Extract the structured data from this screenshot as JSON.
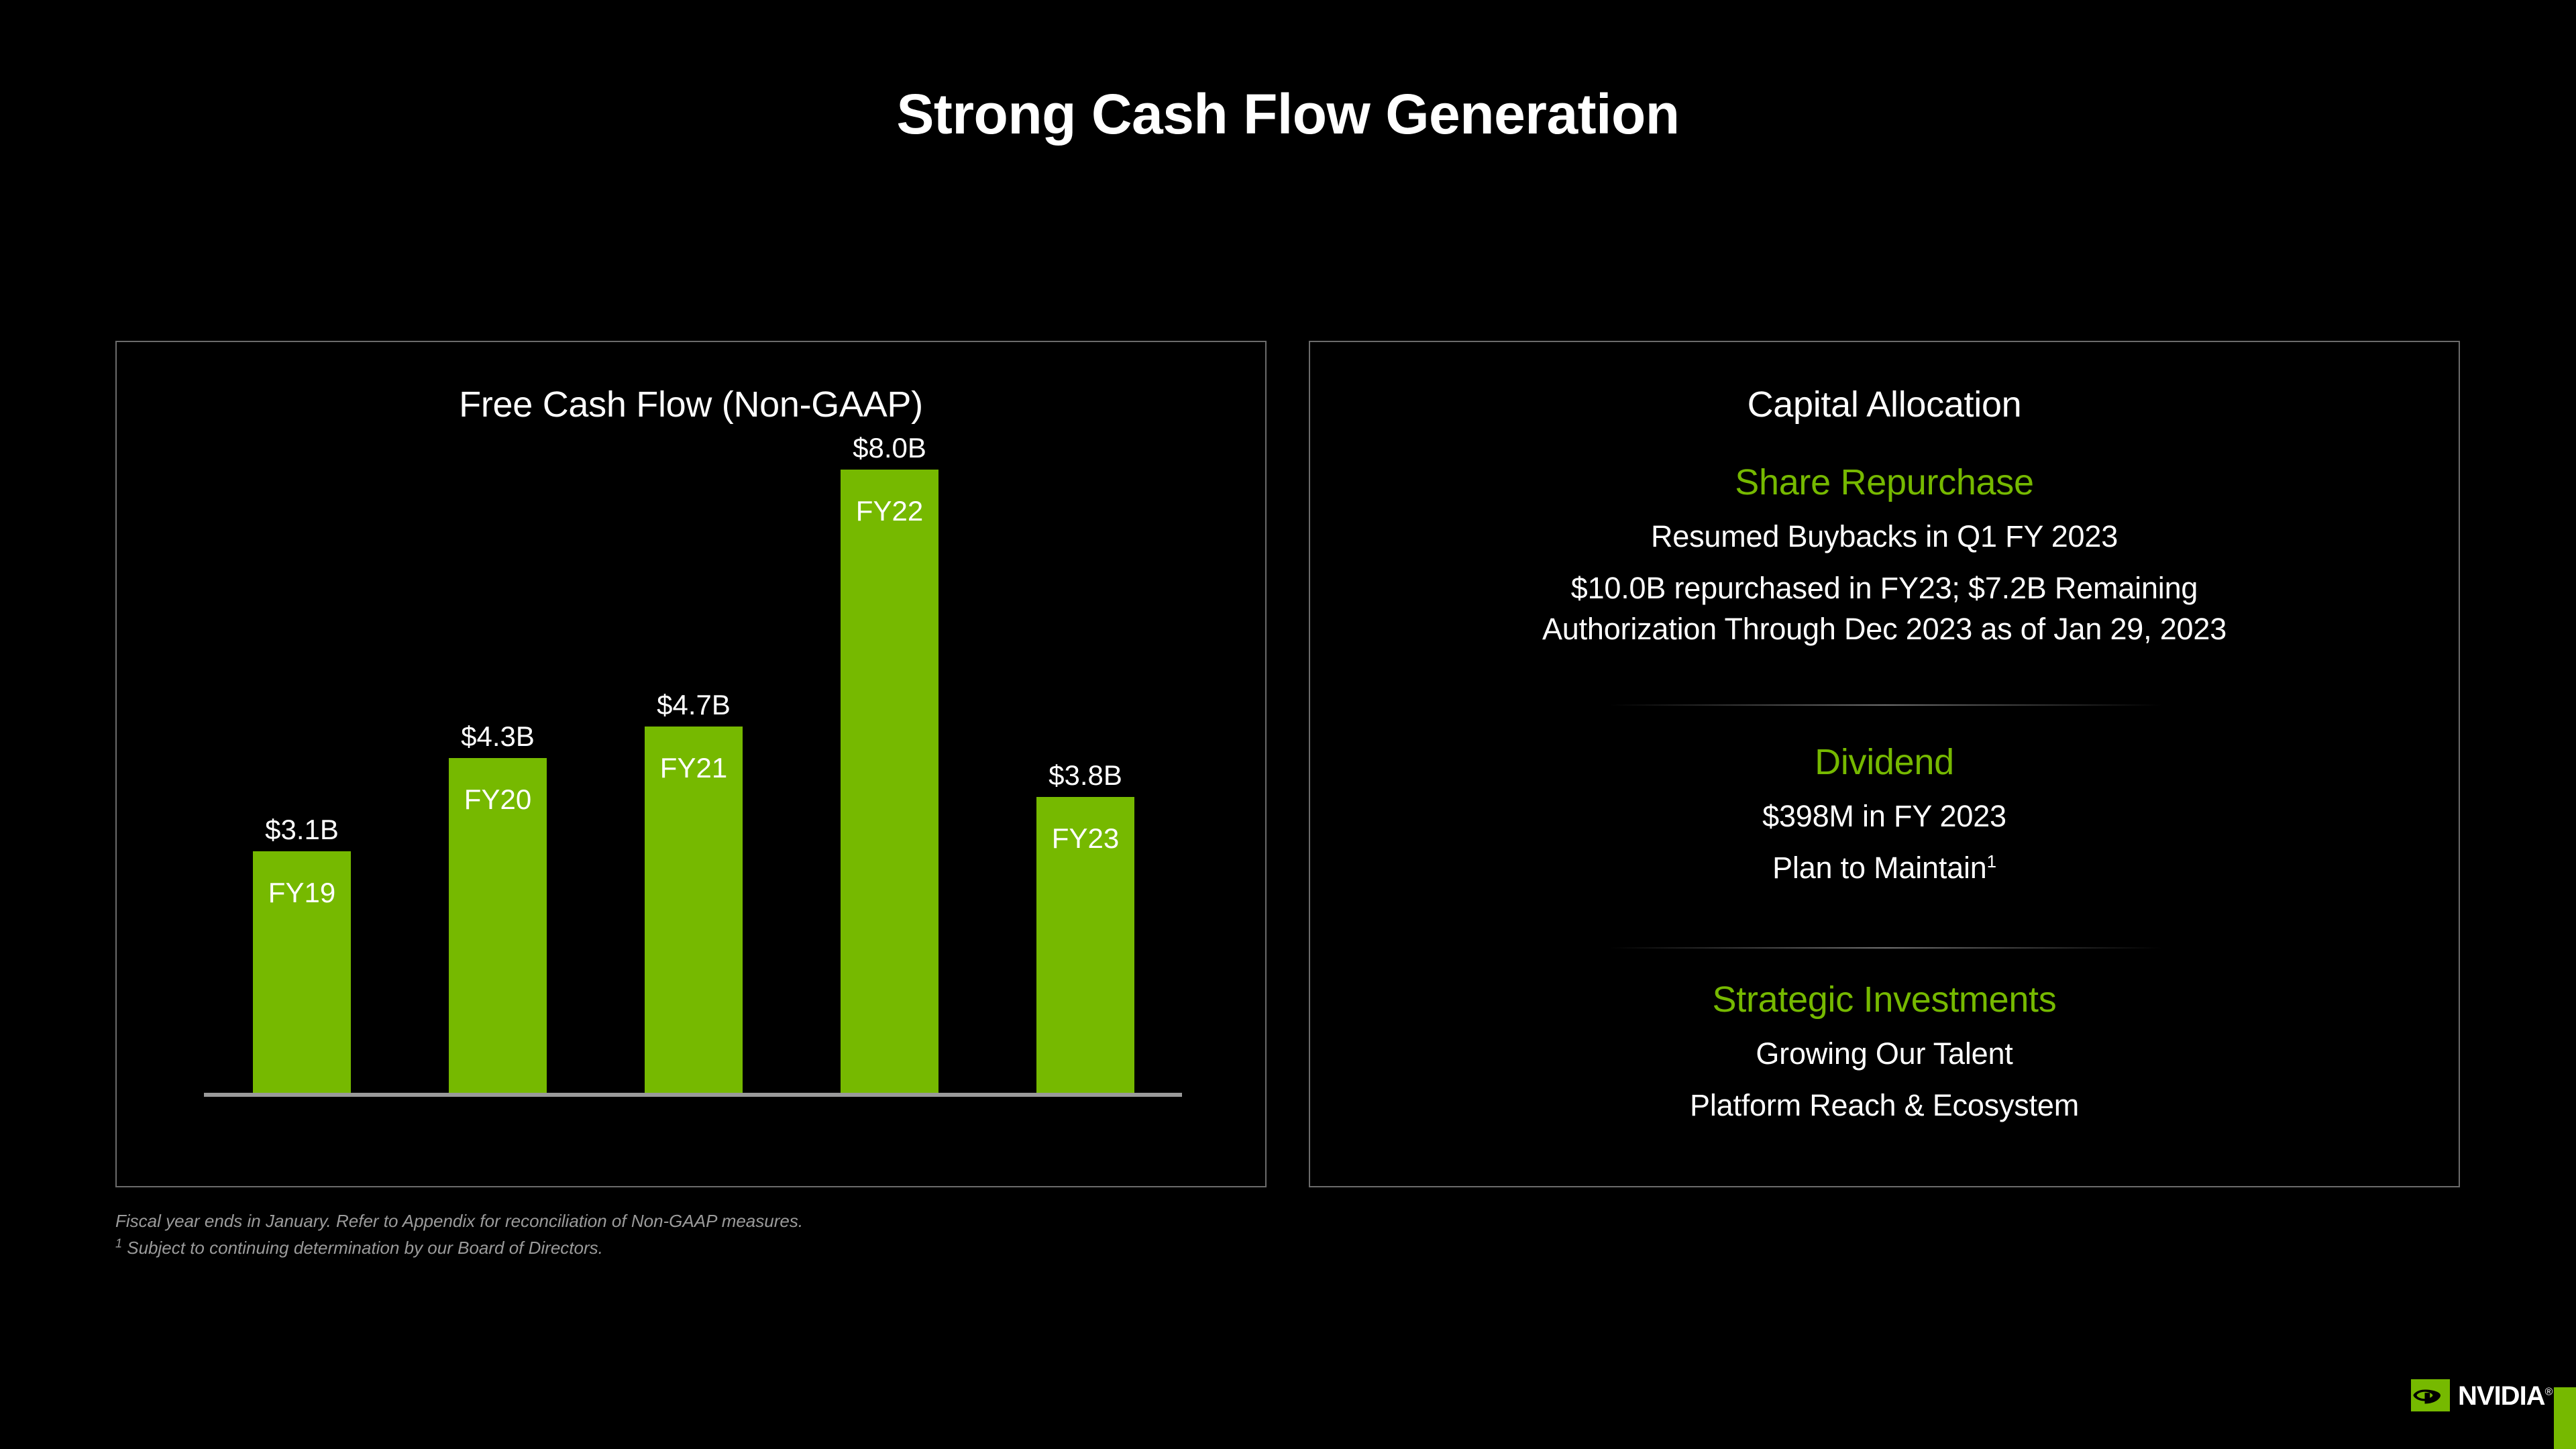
{
  "slide": {
    "title": "Strong Cash Flow Generation",
    "background_color": "#000000",
    "accent_color": "#76b900",
    "panel_border_color": "#6b6b6b"
  },
  "chart_panel": {
    "title": "Free Cash Flow (Non-GAAP)"
  },
  "chart_data": {
    "type": "bar",
    "title": "Free Cash Flow (Non-GAAP)",
    "xlabel": "",
    "ylabel": "",
    "categories": [
      "FY19",
      "FY20",
      "FY21",
      "FY22",
      "FY23"
    ],
    "values": [
      3.1,
      4.3,
      4.7,
      8.0,
      3.8
    ],
    "value_labels": [
      "$3.1B",
      "$4.3B",
      "$4.7B",
      "$8.0B",
      "$3.8B"
    ],
    "unit": "USD billions",
    "ylim": [
      0,
      8.0
    ],
    "grid": false,
    "legend": false,
    "bar_color": "#76b900",
    "axis_color": "#9a9a9a"
  },
  "capital_panel": {
    "title": "Capital Allocation",
    "sections": [
      {
        "heading": "Share Repurchase",
        "lines": [
          "Resumed Buybacks in Q1 FY 2023",
          "$10.0B repurchased in FY23; $7.2B Remaining",
          "Authorization Through Dec 2023 as of Jan 29, 2023"
        ]
      },
      {
        "heading": "Dividend",
        "lines": [
          "$398M in FY 2023",
          "Plan to Maintain"
        ],
        "footnote_marker": "1"
      },
      {
        "heading": "Strategic Investments",
        "lines": [
          "Growing Our Talent",
          "Platform Reach & Ecosystem"
        ]
      }
    ]
  },
  "footnotes": {
    "line1": "Fiscal year ends in January. Refer to Appendix for reconciliation of Non-GAAP measures.",
    "marker2": "1",
    "line2": "Subject to continuing determination by our Board of Directors."
  },
  "branding": {
    "wordmark": "NVIDIA",
    "trademark": "®"
  }
}
